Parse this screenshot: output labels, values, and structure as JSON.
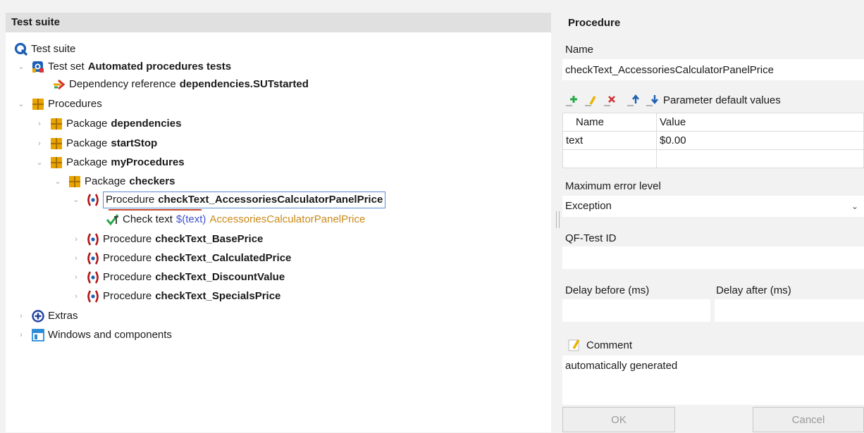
{
  "tree": {
    "header": "Test suite",
    "nodes": [
      {
        "kind": "Test suite",
        "name": ""
      },
      {
        "kind": "Test set",
        "name": "Automated procedures tests"
      },
      {
        "kind": "Dependency reference",
        "name": "dependencies.SUTstarted"
      },
      {
        "kind": "Procedures",
        "name": ""
      },
      {
        "kind": "Package",
        "name": "dependencies"
      },
      {
        "kind": "Package",
        "name": "startStop"
      },
      {
        "kind": "Package",
        "name": "myProcedures"
      },
      {
        "kind": "Package",
        "name": "checkers"
      },
      {
        "kind": "Procedure",
        "name": "checkText_AccessoriesCalculatorPanelPrice"
      },
      {
        "kind": "Check text",
        "var": "$(text)",
        "target": "AccessoriesCalculatorPanelPrice"
      },
      {
        "kind": "Procedure",
        "name": "checkText_BasePrice"
      },
      {
        "kind": "Procedure",
        "name": "checkText_CalculatedPrice"
      },
      {
        "kind": "Procedure",
        "name": "checkText_DiscountValue"
      },
      {
        "kind": "Procedure",
        "name": "checkText_SpecialsPrice"
      },
      {
        "kind": "Extras",
        "name": ""
      },
      {
        "kind": "Windows and components",
        "name": ""
      }
    ]
  },
  "detail": {
    "title": "Procedure",
    "name_label": "Name",
    "name_value": "checkText_AccessoriesCalculatorPanelPrice",
    "params_label": "Parameter default values",
    "params_columns": [
      "Name",
      "Value"
    ],
    "params_rows": [
      {
        "name": "text",
        "value": "$0.00"
      }
    ],
    "max_error_label": "Maximum error level",
    "max_error_value": "Exception",
    "qf_id_label": "QF-Test ID",
    "qf_id_value": "",
    "delay_before_label": "Delay before (ms)",
    "delay_before_value": "",
    "delay_after_label": "Delay after (ms)",
    "delay_after_value": "",
    "comment_label": "Comment",
    "comment_value": "automatically generated",
    "ok_label": "OK",
    "cancel_label": "Cancel"
  },
  "colors": {
    "selection_border": "#5a8dd6",
    "variable": "#3f51d0",
    "check_target": "#c98a1a",
    "procedure_icon": "#b01818",
    "package_icon": "#e8a400"
  },
  "icons": {
    "test_suite": "qf-suite-icon",
    "test_set": "test-set-icon",
    "dependency": "dependency-arrow-icon",
    "package": "package-icon",
    "procedure": "procedure-icon",
    "check": "check-text-icon",
    "extras": "extras-plus-icon",
    "windows": "window-icon"
  }
}
